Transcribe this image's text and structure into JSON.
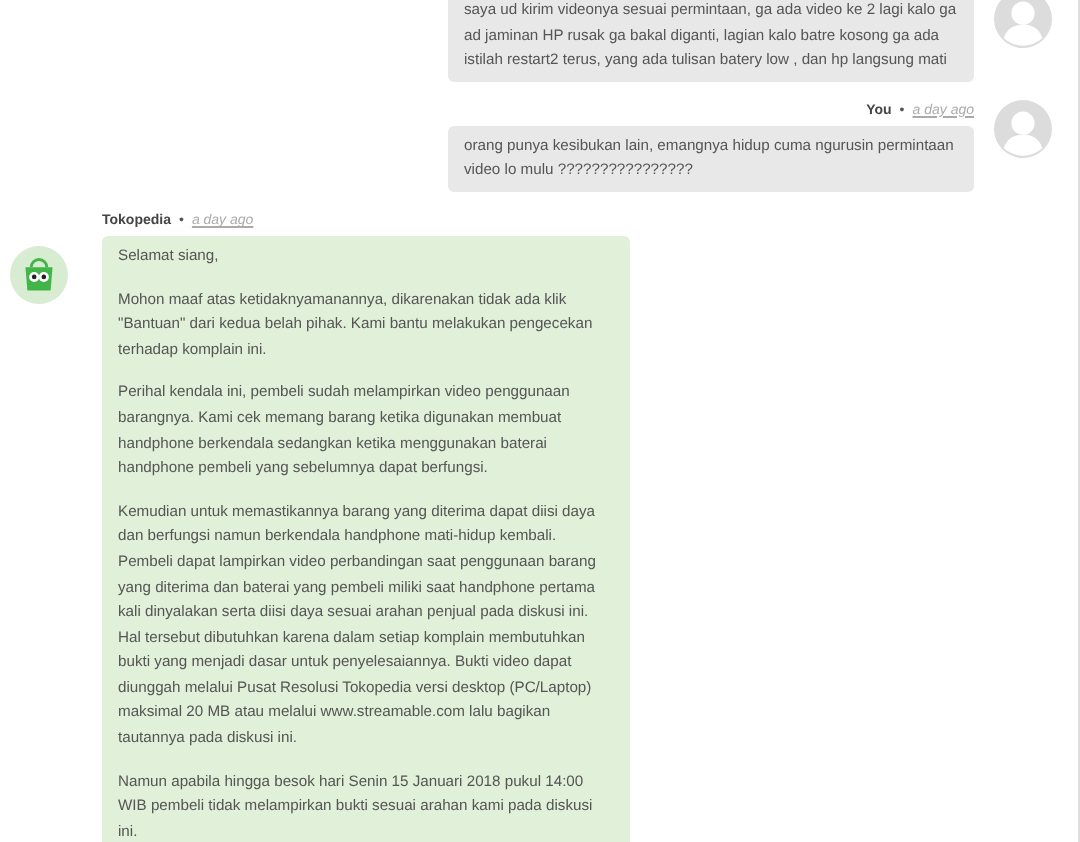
{
  "messages": [
    {
      "kind": "sent",
      "paragraphs": [
        "saya ud kirim videonya sesuai permintaan, ga ada video ke 2 lagi kalo ga ad jaminan HP rusak ga bakal diganti, lagian kalo batre kosong ga ada istilah restart2 terus, yang ada tulisan batery low , dan hp langsung mati"
      ]
    },
    {
      "kind": "sent",
      "author": "You",
      "separator": "•",
      "time": "a day ago",
      "paragraphs": [
        "orang punya kesibukan lain, emangnya hidup cuma ngurusin permintaan video lo mulu ????????????????"
      ]
    },
    {
      "kind": "received",
      "author": "Tokopedia",
      "separator": "•",
      "time": "a day ago",
      "paragraphs": [
        "Selamat siang,",
        "Mohon maaf atas ketidaknyamanannya, dikarenakan tidak ada klik \"Bantuan\" dari kedua belah pihak. Kami bantu melakukan pengecekan terhadap komplain ini.",
        "Perihal kendala ini, pembeli sudah melampirkan video penggunaan barangnya. Kami cek memang barang ketika digunakan membuat handphone berkendala sedangkan ketika menggunakan baterai handphone pembeli yang sebelumnya dapat berfungsi.",
        "Kemudian untuk memastikannya barang yang diterima dapat diisi daya dan berfungsi namun berkendala handphone mati-hidup kembali. Pembeli dapat lampirkan video perbandingan saat penggunaan barang yang diterima dan baterai yang pembeli miliki saat handphone pertama kali dinyalakan serta diisi daya sesuai arahan penjual pada diskusi ini. Hal tersebut dibutuhkan karena dalam setiap komplain membutuhkan bukti yang menjadi dasar untuk penyelesaiannya. Bukti video dapat diunggah melalui Pusat Resolusi Tokopedia versi desktop (PC/Laptop) maksimal 20 MB atau melalui www.streamable.com lalu bagikan tautannya pada diskusi ini.",
        "Namun apabila hingga besok hari Senin 15 Januari 2018 pukul 14:00 WIB pembeli tidak melampirkan bukti sesuai arahan kami pada diskusi ini."
      ]
    }
  ]
}
